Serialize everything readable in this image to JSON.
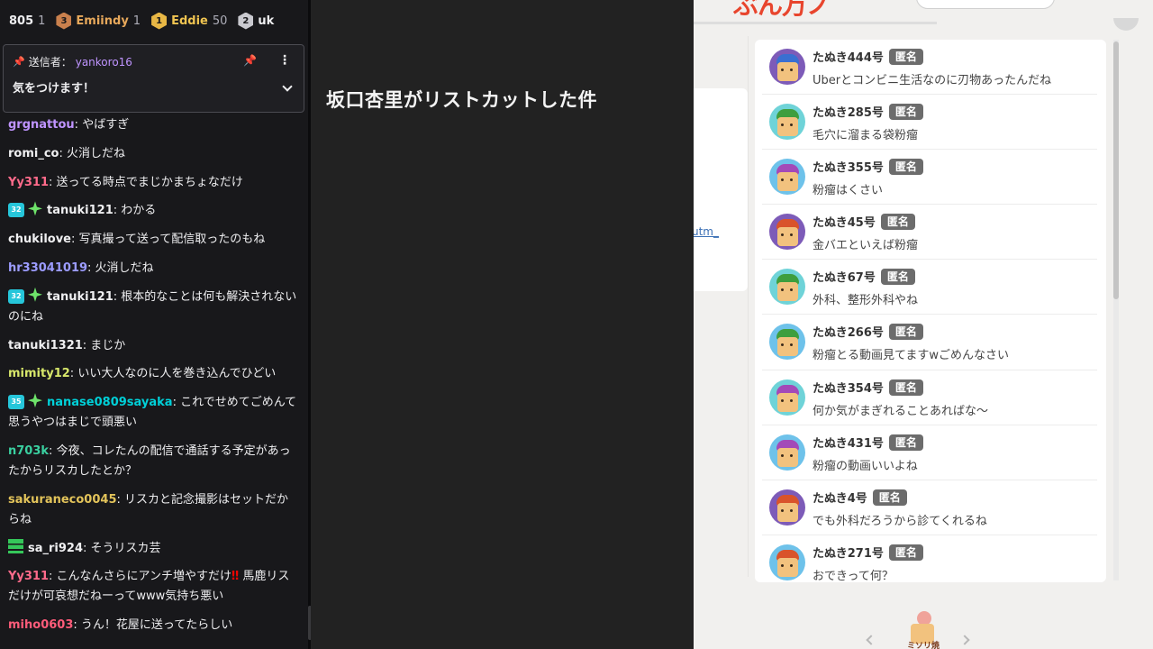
{
  "chat": {
    "leaderboard": [
      {
        "name": "805",
        "count": "1",
        "rank": "",
        "color": "#efeff1"
      },
      {
        "name": "Emiindy",
        "count": "1",
        "rank": "3",
        "color": "#e7a85b"
      },
      {
        "name": "Eddie",
        "count": "50",
        "rank": "1",
        "color": "#f0c451"
      },
      {
        "name": "uk",
        "count": "",
        "rank": "2",
        "color": "#efeff1"
      }
    ],
    "pinned": {
      "sender_label": "送信者：",
      "sender": "yankoro16",
      "message": "気をつけます！"
    },
    "messages": [
      {
        "user": "grgnattou",
        "color": "#bf94ff",
        "text": "やばすぎ"
      },
      {
        "user": "romi_co",
        "color": "#efeff1",
        "text": "火消しだね"
      },
      {
        "user": "Yy311",
        "color": "#ff6b8b",
        "text": "送ってる時点でまじかまちょなだけ"
      },
      {
        "user": "tanuki121",
        "color": "#efeff1",
        "badge": "32",
        "text": "わかる"
      },
      {
        "user": "chukilove",
        "color": "#efeff1",
        "text": "写真撮って送って配信取ったのもね"
      },
      {
        "user": "hr33041019",
        "color": "#9c9cff",
        "text": "火消しだね"
      },
      {
        "user": "tanuki121",
        "color": "#efeff1",
        "badge": "32",
        "text": "根本的なことは何も解決されないのにね"
      },
      {
        "user": "tanuki1321",
        "color": "#efeff1",
        "text": "まじか"
      },
      {
        "user": "mimity12",
        "color": "#d8e86b",
        "text": "いい大人なのに人を巻き込んでひどい"
      },
      {
        "user": "nanase0809sayaka",
        "color": "#00d0d8",
        "badge": "35",
        "text": "これでせめてごめんて思うやつはまじで頭悪い"
      },
      {
        "user": "n703k",
        "color": "#3ad0a0",
        "text": "今夜、コレたんの配信で通話する予定があったからリスカしたとか？"
      },
      {
        "user": "sakuraneco0045",
        "color": "#e2c35a",
        "text": "リスカと記念撮影はセットだからね"
      },
      {
        "user": "sa_ri924",
        "color": "#efeff1",
        "text": "そうリスカ芸"
      },
      {
        "user": "Yy311",
        "color": "#ff6b8b",
        "text_before": "こんなんさらにアンチ増やすだけ",
        "excl": "‼",
        "text": "馬鹿リスだけが可哀想だねーってwww気持ち悪い"
      },
      {
        "user": "miho0603",
        "color": "#ff5c7a",
        "text": "うん！花屋に送ってたらしい"
      }
    ]
  },
  "middle": {
    "title": "坂口杏里がリストカットした件"
  },
  "web": {
    "logo": "ぶん万ノ",
    "side_link": "utm_",
    "anonymous_tag": "匿名",
    "comments": [
      {
        "name": "たぬき444号",
        "text": "Uberとコンビニ生活なのに刃物あったんだね",
        "avatar": "purple-blue"
      },
      {
        "name": "たぬき285号",
        "text": "毛穴に溜まる袋粉瘤",
        "avatar": "teal-green"
      },
      {
        "name": "たぬき355号",
        "text": "粉瘤はくさい",
        "avatar": "blue-purple"
      },
      {
        "name": "たぬき45号",
        "text": "金バエといえば粉瘤",
        "avatar": "purple-orange"
      },
      {
        "name": "たぬき67号",
        "text": "外科、整形外科やね",
        "avatar": "teal-green"
      },
      {
        "name": "たぬき266号",
        "text": "粉瘤とる動画見てますwごめんなさい",
        "avatar": "blue-green"
      },
      {
        "name": "たぬき354号",
        "text": "何か気がまぎれることあればな〜",
        "avatar": "teal-purple"
      },
      {
        "name": "たぬき431号",
        "text": "粉瘤の動画いいよね",
        "avatar": "blue-purple"
      },
      {
        "name": "たぬき4号",
        "text": "でも外科だろうから診てくれるね",
        "avatar": "purple-orange"
      },
      {
        "name": "たぬき271号",
        "text": "おできって何？",
        "avatar": "blue-orange"
      }
    ],
    "mascot_label": "ミソリ焼金"
  }
}
